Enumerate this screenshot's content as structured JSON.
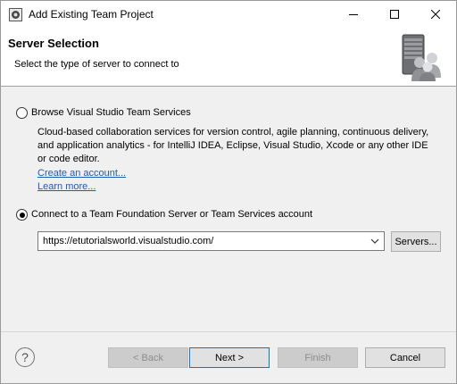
{
  "window": {
    "title": "Add Existing Team Project",
    "controls": {
      "minimize": "minimize-icon",
      "maximize": "maximize-icon",
      "close": "close-icon"
    }
  },
  "header": {
    "title": "Server Selection",
    "subtitle": "Select the type of server to connect to",
    "graphic": "server-users-icon"
  },
  "options": {
    "browse": {
      "label": "Browse Visual Studio Team Services",
      "selected": false,
      "description": "Cloud-based collaboration services for version control, agile planning, continuous delivery, and application analytics - for IntelliJ IDEA, Eclipse, Visual Studio, Xcode or any other IDE or code editor.",
      "links": [
        "Create an account...",
        "Learn more..."
      ]
    },
    "connect": {
      "label": "Connect to a Team Foundation Server or Team Services account",
      "selected": true,
      "server_url": "https://etutorialsworld.visualstudio.com/",
      "servers_button": "Servers..."
    }
  },
  "footer": {
    "help_icon": "help-icon",
    "back": "< Back",
    "next": "Next >",
    "finish": "Finish",
    "cancel": "Cancel"
  },
  "colors": {
    "link": "#1a5fb4",
    "dialog_bg": "#f0f0f0",
    "focus_border": "#0078d7"
  }
}
